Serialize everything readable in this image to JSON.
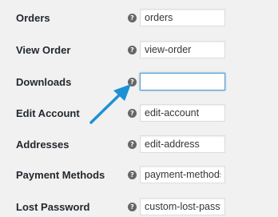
{
  "settings": {
    "orders": {
      "label": "Orders",
      "value": "orders"
    },
    "view_order": {
      "label": "View Order",
      "value": "view-order"
    },
    "downloads": {
      "label": "Downloads",
      "value": ""
    },
    "edit_account": {
      "label": "Edit Account",
      "value": "edit-account"
    },
    "addresses": {
      "label": "Addresses",
      "value": "edit-address"
    },
    "payment_methods": {
      "label": "Payment Methods",
      "value": "payment-methods"
    },
    "lost_password": {
      "label": "Lost Password",
      "value": "custom-lost-password"
    }
  },
  "help_icon": {
    "glyph": "?",
    "icon": "question-circle-icon"
  },
  "colors": {
    "background": "#f1f1f1",
    "arrow": "#1e90d6",
    "focus_border": "#5b9dd9"
  }
}
